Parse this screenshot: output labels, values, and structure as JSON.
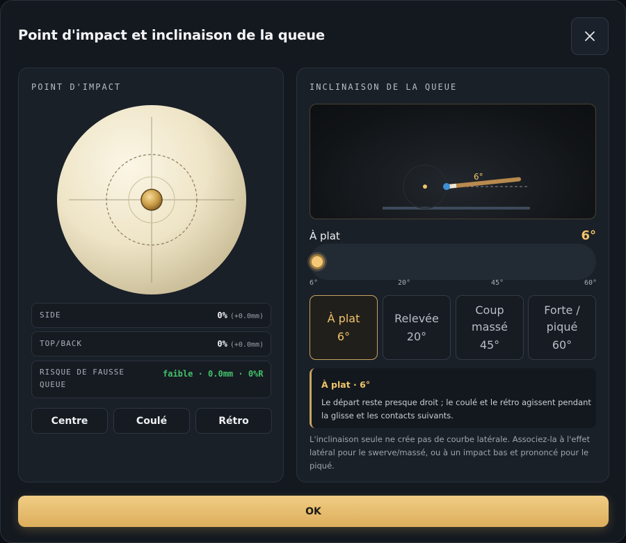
{
  "dialog": {
    "title": "Point d'impact et inclinaison de la queue",
    "close_icon": "close-icon"
  },
  "impact": {
    "heading": "POINT D'IMPACT",
    "side": {
      "label": "SIDE",
      "value": "0%",
      "sub": "(+0.0mm)"
    },
    "topback": {
      "label": "TOP/BACK",
      "value": "0%",
      "sub": "(+0.0mm)"
    },
    "risk": {
      "label": "RISQUE DE FAUSSE QUEUE",
      "value": "faible · 0.0mm · 0%R"
    },
    "presets": [
      "Centre",
      "Coulé",
      "Rétro"
    ],
    "ball_color": "#f1ead2"
  },
  "elevation": {
    "heading": "INCLINAISON DE LA QUEUE",
    "diagram_angle_label": "6°",
    "current_label": "À plat",
    "current_value": "6°",
    "slider": {
      "min": 6,
      "max": 60,
      "value": 6
    },
    "ticks": [
      "6°",
      "20°",
      "45°",
      "60°"
    ],
    "options": [
      {
        "name": "À plat",
        "deg": "6°",
        "active": true
      },
      {
        "name": "Relevée",
        "deg": "20°",
        "active": false
      },
      {
        "name": "Coup massé",
        "deg": "45°",
        "active": false
      },
      {
        "name": "Forte / piqué",
        "deg": "60°",
        "active": false
      }
    ],
    "info": {
      "title": "À plat · 6°",
      "text": "Le départ reste presque droit ; le coulé et le rétro agissent pendant la glisse et les contacts suivants."
    },
    "note": "L'inclinaison seule ne crée pas de courbe latérale. Associez-la à l'effet latéral pour le swerve/massé, ou à un impact bas et prononcé pour le piqué."
  },
  "ok_label": "OK",
  "colors": {
    "accent": "#f2c46a",
    "success": "#43c06a",
    "background": "#141920"
  }
}
